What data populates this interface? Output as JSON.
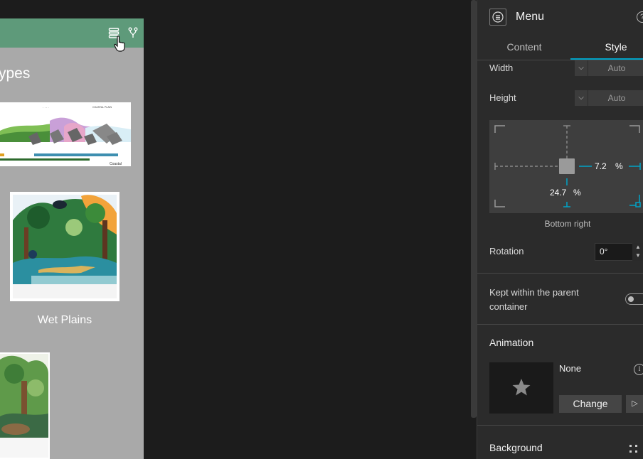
{
  "preview": {
    "title_partial": "ypes",
    "wet_plains_caption": "Wet Plains",
    "coastal_img": {
      "tag_coastal": "Coastal",
      "tag_plain": "COASTAL PLAIN"
    }
  },
  "panel": {
    "title": "Menu",
    "help_icon": "?",
    "tabs": [
      {
        "label": "Content"
      },
      {
        "label": "Style"
      }
    ],
    "active_tab": "Style",
    "width": {
      "label": "Width",
      "value": "Auto"
    },
    "height": {
      "label": "Height",
      "value": "Auto"
    },
    "position": {
      "right_offset": "7.2",
      "right_unit": "%",
      "bottom_offset": "24.7",
      "bottom_unit": "%",
      "anchor_label": "Bottom right"
    },
    "rotation": {
      "label": "Rotation",
      "value": "0°"
    },
    "kept_within_parent": {
      "label_line1": "Kept within the parent",
      "label_line2": "container",
      "enabled": false
    },
    "animation": {
      "heading": "Animation",
      "value": "None",
      "change_label": "Change"
    },
    "background": {
      "heading": "Background"
    }
  },
  "colors": {
    "accent": "#00a3c7",
    "header_green": "#5e9a7a",
    "preview_bg": "#a9a9a9",
    "panel_bg": "#2b2b2b"
  }
}
